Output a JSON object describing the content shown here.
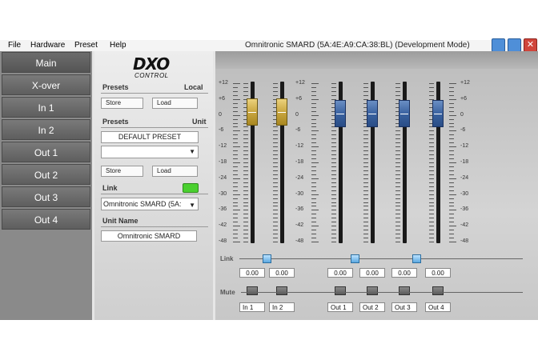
{
  "menu": {
    "file": "File",
    "hardware": "Hardware",
    "preset": "Preset",
    "help": "Help"
  },
  "window_title": "Omnitronic SMARD (5A:4E:A9:CA:38:BL) (Development Mode)",
  "nav": [
    {
      "label": "Main"
    },
    {
      "label": "X-over"
    },
    {
      "label": "In 1"
    },
    {
      "label": "In 2"
    },
    {
      "label": "Out 1"
    },
    {
      "label": "Out 2"
    },
    {
      "label": "Out 3"
    },
    {
      "label": "Out 4"
    }
  ],
  "panel": {
    "logo": "DXO",
    "logo_sub": "CONTROL",
    "presets_label": "Presets",
    "local_label": "Local",
    "unit_label": "Unit",
    "store_label": "Store",
    "load_label": "Load",
    "default_preset": "DEFAULT PRESET",
    "dropdown_value": "",
    "link_label": "Link",
    "device_select": "Omnitronic SMARD (5A:",
    "unit_name_label": "Unit Name",
    "unit_name_value": "Omnitronic SMARD"
  },
  "mixer": {
    "scale": [
      "+12",
      "+6",
      "0",
      "-6",
      "-12",
      "-18",
      "-24",
      "-30",
      "-36",
      "-42",
      "-48"
    ],
    "link_label": "Link",
    "mute_label": "Mute",
    "channels": [
      {
        "name": "In 1",
        "value": "0.00",
        "color": "#c9a640"
      },
      {
        "name": "In 2",
        "value": "0.00",
        "color": "#c9a640"
      },
      {
        "name": "Out 1",
        "value": "0.00",
        "color": "#3a62a0"
      },
      {
        "name": "Out 2",
        "value": "0.00",
        "color": "#3a62a0"
      },
      {
        "name": "Out 3",
        "value": "0.00",
        "color": "#3a62a0"
      },
      {
        "name": "Out 4",
        "value": "0.00",
        "color": "#3a62a0"
      }
    ]
  }
}
